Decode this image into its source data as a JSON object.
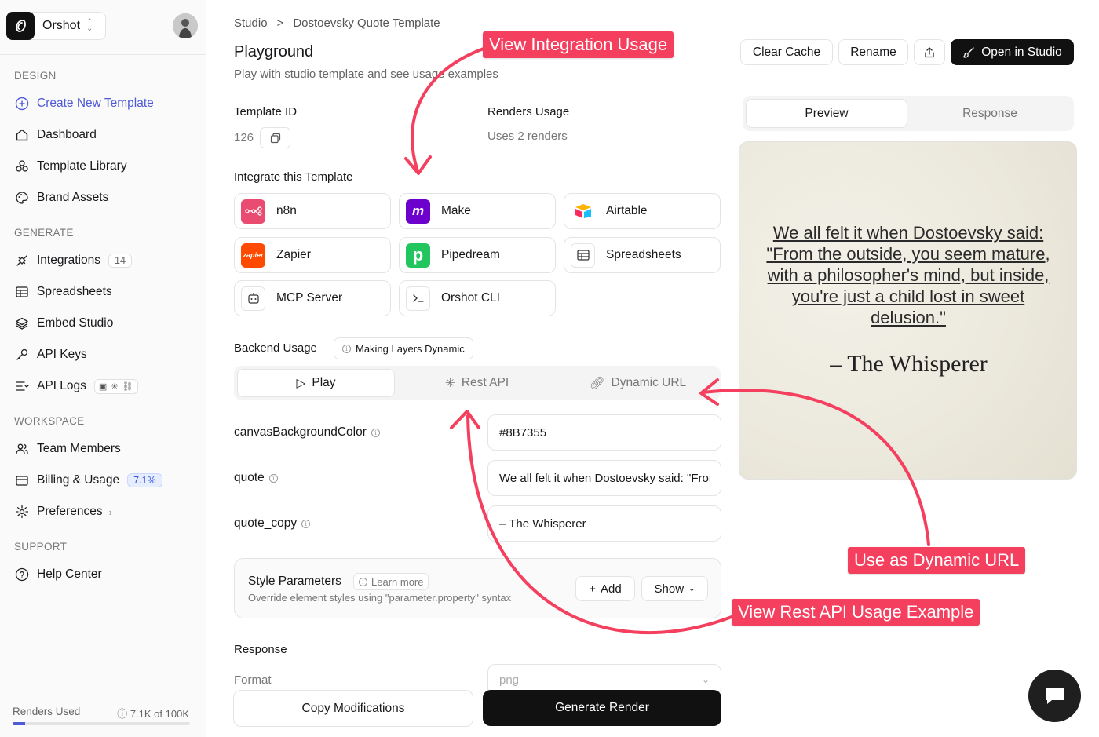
{
  "workspace": {
    "name": "Orshot"
  },
  "sidebar": {
    "sections": {
      "design": "DESIGN",
      "generate": "GENERATE",
      "workspace": "WORKSPACE",
      "support": "SUPPORT"
    },
    "items": {
      "create": "Create New Template",
      "dashboard": "Dashboard",
      "library": "Template Library",
      "brand": "Brand Assets",
      "integrations": "Integrations",
      "integrations_badge": "14",
      "spreadsheets": "Spreadsheets",
      "embed": "Embed Studio",
      "apikeys": "API Keys",
      "apilogs": "API Logs",
      "team": "Team Members",
      "billing": "Billing & Usage",
      "billing_badge": "7.1%",
      "preferences": "Preferences",
      "help": "Help Center"
    },
    "renders": {
      "label": "Renders Used",
      "count": "7.1K of 100K",
      "fraction": 0.071
    }
  },
  "breadcrumb": {
    "root": "Studio",
    "sep": ">",
    "current": "Dostoevsky Quote Template"
  },
  "page": {
    "title": "Playground",
    "subtitle": "Play with studio template and see usage examples"
  },
  "template": {
    "id_label": "Template ID",
    "id_value": "126",
    "usage_label": "Renders Usage",
    "usage_value": "Uses 2 renders"
  },
  "integrate": {
    "title": "Integrate this Template",
    "items": [
      "n8n",
      "Make",
      "Airtable",
      "Zapier",
      "Pipedream",
      "Spreadsheets",
      "MCP Server",
      "Orshot CLI"
    ]
  },
  "backend": {
    "title": "Backend Usage",
    "chip": "Making Layers Dynamic",
    "tabs": [
      "Play",
      "Rest API",
      "Dynamic URL"
    ]
  },
  "fields": [
    {
      "label": "canvasBackgroundColor",
      "value": "#8B7355"
    },
    {
      "label": "quote",
      "value": "We all felt it when Dostoevsky said: \"From the outside, you seem mature, with a philosopher's mind, but inside, you're just a child lost in sweet delusion.\""
    },
    {
      "label": "quote_copy",
      "value": "– The Whisperer"
    }
  ],
  "style_params": {
    "title": "Style Parameters",
    "learn": "Learn more",
    "subtitle": "Override element styles using \"parameter.property\" syntax",
    "add": "Add",
    "show": "Show"
  },
  "response": {
    "title": "Response",
    "format_label": "Format",
    "format_value": "png"
  },
  "actions": {
    "copy": "Copy Modifications",
    "generate": "Generate Render"
  },
  "toolbar": {
    "clear": "Clear Cache",
    "rename": "Rename",
    "open": "Open in Studio"
  },
  "preview_tabs": [
    "Preview",
    "Response"
  ],
  "preview": {
    "quote": "We all felt it when Dostoevsky said: \"From the outside, you seem mature, with a philosopher's mind, but inside, you're just a child lost in sweet delusion.\"",
    "author": "– The Whisperer"
  },
  "callouts": {
    "integration": "View Integration Usage",
    "dynamic": "Use as Dynamic URL",
    "rest": "View Rest API Usage Example"
  },
  "colors": {
    "accent": "#4f5bd5",
    "callout": "#f43f5e",
    "dark": "#111111"
  }
}
